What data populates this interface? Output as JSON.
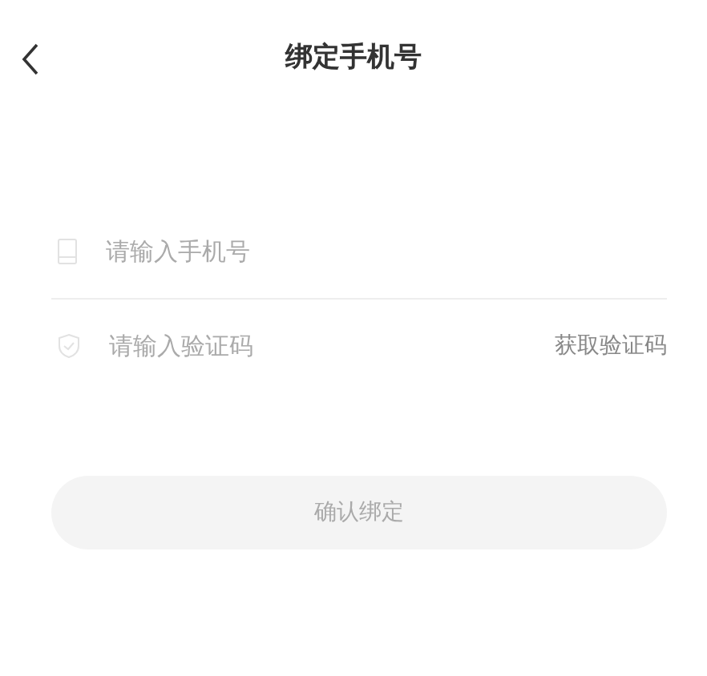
{
  "header": {
    "title": "绑定手机号"
  },
  "phone_field": {
    "placeholder": "请输入手机号"
  },
  "code_field": {
    "placeholder": "请输入验证码",
    "action": "获取验证码"
  },
  "submit_button": {
    "label": "确认绑定",
    "disabled": true
  }
}
